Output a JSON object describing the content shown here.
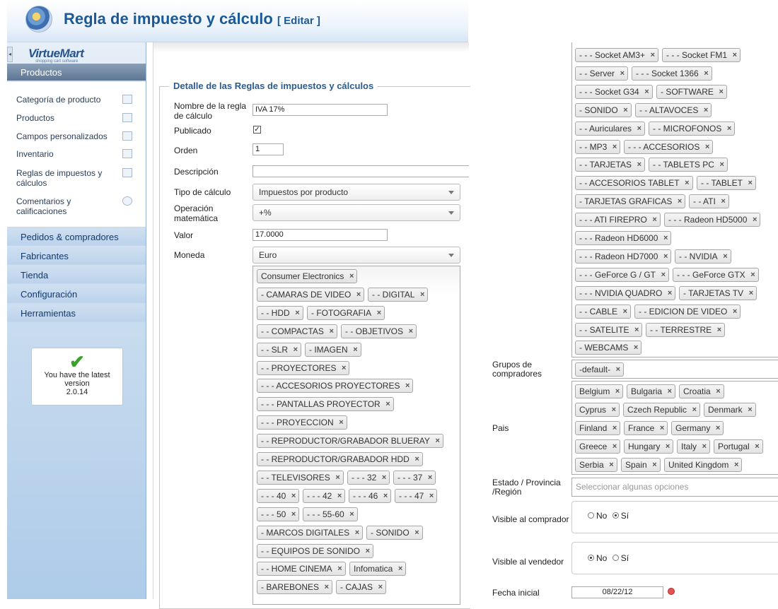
{
  "header": {
    "title": "Regla de impuesto y cálculo",
    "edit": "[ Editar ]"
  },
  "sidebar": {
    "logo": "VirtueMart",
    "logo_sub": "shopping cart software",
    "section": "Productos",
    "items": [
      {
        "label": "Categoría de producto",
        "icon": "category-icon"
      },
      {
        "label": "Productos",
        "icon": "product-icon"
      },
      {
        "label": "Campos personalizados",
        "icon": "custom-fields-icon"
      },
      {
        "label": "Inventario",
        "icon": "inventory-icon"
      },
      {
        "label": "Reglas de impuestos y cálculos",
        "icon": "tax-icon"
      },
      {
        "label": "Comentarios y calificaciones",
        "icon": "comments-icon"
      }
    ],
    "groups": [
      "Pedidos & compradores",
      "Fabricantes",
      "Tienda",
      "Configuración",
      "Herramientas"
    ],
    "version_text": "You have the latest version",
    "version": "2.0.14"
  },
  "form": {
    "legend": "Detalle de las Reglas de impuestos y cálculos",
    "name_label": "Nombre de la regla de cálculo",
    "name_value": "IVA 17%",
    "published_label": "Publicado",
    "published_check": "✓",
    "order_label": "Orden",
    "order_value": "1",
    "description_label": "Descripción",
    "calc_type_label": "Tipo de cálculo",
    "calc_type_value": "Impuestos por producto",
    "math_op_label": "Operación matemática",
    "math_op_value": "+%",
    "value_label": "Valor",
    "value_value": "17.0000",
    "currency_label": "Moneda",
    "currency_value": "Euro"
  },
  "categories_left": [
    [
      "Consumer Electronics"
    ],
    [
      "- CAMARAS DE VIDEO",
      "- - DIGITAL"
    ],
    [
      "- - HDD",
      "- FOTOGRAFIA"
    ],
    [
      "- - COMPACTAS",
      "- - OBJETIVOS"
    ],
    [
      "- - SLR",
      "- IMAGEN"
    ],
    [
      "- - PROYECTORES"
    ],
    [
      "- - - ACCESORIOS PROYECTORES"
    ],
    [
      "- - - PANTALLAS PROYECTOR"
    ],
    [
      "- - - PROYECCION"
    ],
    [
      "- - REPRODUCTOR/GRABADOR BLUERAY"
    ],
    [
      "- - REPRODUCTOR/GRABADOR HDD"
    ],
    [
      "- - TELEVISORES",
      "- - - 32",
      "- - - 37"
    ],
    [
      "- - - 40",
      "- - - 42",
      "- - - 46",
      "- - - 47"
    ],
    [
      "- - - 50",
      "- - - 55-60"
    ],
    [
      "- MARCOS DIGITALES",
      "- SONIDO"
    ],
    [
      "- - EQUIPOS DE SONIDO"
    ],
    [
      "- - HOME CINEMA",
      "Infomatica"
    ],
    [
      "- BAREBONES",
      "- CAJAS"
    ]
  ],
  "categories_right": [
    [
      "- - - Socket AM3+",
      "- - - Socket FM1"
    ],
    [
      "- - Server",
      "- - - Socket 1366"
    ],
    [
      "- - - Socket G34",
      "- SOFTWARE"
    ],
    [
      "- SONIDO",
      "- - ALTAVOCES"
    ],
    [
      "- - Auriculares",
      "- - MICROFONOS"
    ],
    [
      "- - MP3",
      "- - - ACCESORIOS"
    ],
    [
      "- - TARJETAS",
      "- - TABLETS PC"
    ],
    [
      "- - ACCESORIOS TABLET",
      "- - TABLET"
    ],
    [
      "- TARJETAS GRAFICAS",
      "- - ATI"
    ],
    [
      "- - - ATI FIREPRO",
      "- - - Radeon HD5000"
    ],
    [
      "- - - Radeon HD6000"
    ],
    [
      "- - - Radeon HD7000",
      "- - NVIDIA"
    ],
    [
      "- - - GeForce G / GT",
      "- - - GeForce GTX"
    ],
    [
      "- - - NVIDIA QUADRO",
      "- TARJETAS TV"
    ],
    [
      "- - CABLE",
      "- - EDICION DE VIDEO"
    ],
    [
      "- - SATELITE",
      "- - TERRESTRE"
    ],
    [
      "- WEBCAMS"
    ]
  ],
  "right": {
    "shopper_groups_label": "Grupos de compradores",
    "shopper_groups": [
      "-default-"
    ],
    "country_label": "Pais",
    "countries": [
      [
        "Belgium",
        "Bulgaria",
        "Croatia"
      ],
      [
        "Cyprus",
        "Czech Republic",
        "Denmark"
      ],
      [
        "Finland",
        "France",
        "Germany"
      ],
      [
        "Greece",
        "Hungary",
        "Italy",
        "Portugal"
      ],
      [
        "Serbia",
        "Spain",
        "United Kingdom"
      ]
    ],
    "state_label": "Estado / Provincia /Región",
    "state_placeholder": "Seleccionar algunas opciones",
    "visible_shopper_label": "Visible al comprador",
    "visible_vendor_label": "Visible al vendedor",
    "no": "No",
    "yes": "Sí",
    "start_date_label": "Fecha inicial",
    "start_date_value": "08/22/12"
  }
}
